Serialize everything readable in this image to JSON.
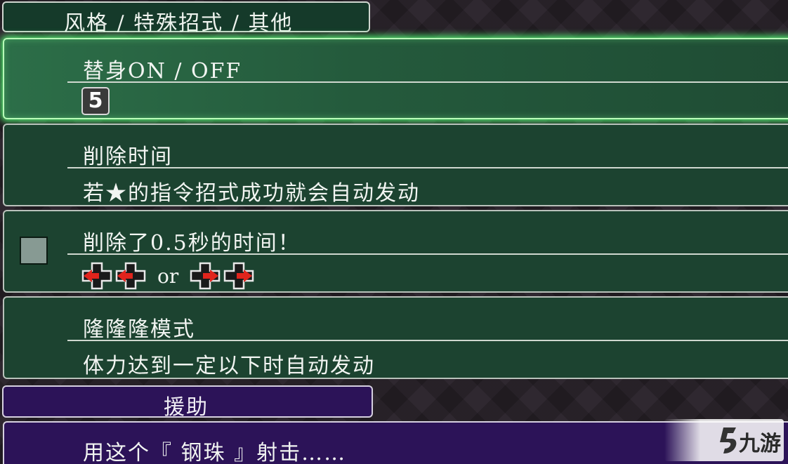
{
  "section_header": "风格 / 特殊招式 / 其他",
  "rows": [
    {
      "title": "替身ON / OFF",
      "badge": "5"
    },
    {
      "title": "削除时间",
      "desc": "若★的指令招式成功就会自动发动"
    },
    {
      "title": "削除了0.5秒的时间！",
      "or_text": "or"
    },
    {
      "title": "隆隆隆模式",
      "desc": "体力达到一定以下时自动发动"
    }
  ],
  "assist_header": "援助",
  "assist_row": {
    "title": "用这个『 钢珠 』射击……"
  },
  "watermark": {
    "text": "九游"
  },
  "colors": {
    "panel_green": "#1c4330",
    "panel_selected_glow": "#4ee86e",
    "panel_purple": "#2c1358",
    "arrow_red": "#e0241c"
  },
  "icons": {
    "badge": "number-5-button-icon",
    "checkbox": "unchecked-box-icon",
    "inputs": [
      "dpad-left-icon",
      "dpad-left-icon",
      "dpad-right-icon",
      "dpad-right-icon"
    ]
  }
}
